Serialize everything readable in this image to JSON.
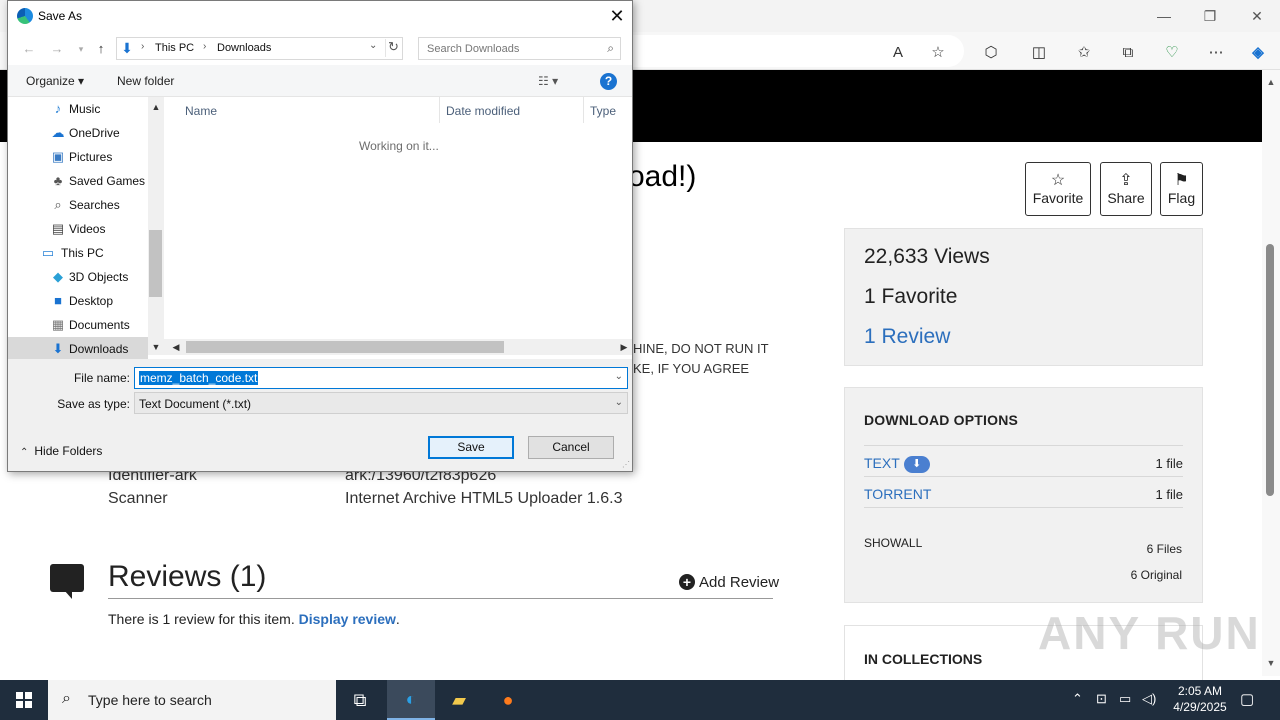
{
  "browser": {
    "window_controls": {
      "minimize": "—",
      "restore": "❐",
      "close": "✕"
    },
    "toolbar_icons": [
      "read-aloud-icon",
      "favorite-star-icon",
      "extensions-icon",
      "split-screen-icon",
      "favorites-icon",
      "collections-icon",
      "browser-essentials-icon",
      "more-icon",
      "copilot-icon"
    ]
  },
  "page": {
    "title_fragment": "oad!)",
    "actions": {
      "favorite": "Favorite",
      "share": "Share",
      "flag": "Flag"
    },
    "stats": {
      "views": "22,633 Views",
      "favorites": "1 Favorite",
      "reviews": "1 Review"
    },
    "download": {
      "title": "DOWNLOAD OPTIONS",
      "rows": [
        {
          "name": "TEXT",
          "count": "1 file"
        },
        {
          "name": "TORRENT",
          "count": "1 file"
        }
      ],
      "show_all": "SHOWALL",
      "files": "6 Files",
      "original": "6 Original"
    },
    "collections_title": "IN COLLECTIONS",
    "desc_fragment_1": "HINE, DO NOT RUN IT",
    "desc_fragment_2": "KE, IF YOU AGREE",
    "metadata": [
      {
        "key": "Identifier-ark",
        "value": "ark:/13960/t2f83p626"
      },
      {
        "key": "Scanner",
        "value": "Internet Archive HTML5 Uploader 1.6.3"
      }
    ],
    "reviews_heading": "Reviews (1)",
    "add_review": "Add Review",
    "review_text": "There is 1 review for this item.",
    "review_link": "Display review",
    "review_period": ".",
    "watermark": "ANY RUN"
  },
  "dialog": {
    "title": "Save As",
    "close": "✕",
    "breadcrumb": [
      "This PC",
      "Downloads"
    ],
    "search_placeholder": "Search Downloads",
    "organize": "Organize ▾",
    "new_folder": "New folder",
    "view": "☷ ▾",
    "help": "?",
    "tree": [
      {
        "label": "Music",
        "icon": "music-icon"
      },
      {
        "label": "OneDrive",
        "icon": "onedrive-icon"
      },
      {
        "label": "Pictures",
        "icon": "pictures-icon"
      },
      {
        "label": "Saved Games",
        "icon": "saved-games-icon"
      },
      {
        "label": "Searches",
        "icon": "searches-icon"
      },
      {
        "label": "Videos",
        "icon": "videos-icon"
      },
      {
        "label": "This PC",
        "icon": "this-pc-icon"
      },
      {
        "label": "3D Objects",
        "icon": "3d-objects-icon"
      },
      {
        "label": "Desktop",
        "icon": "desktop-icon"
      },
      {
        "label": "Documents",
        "icon": "documents-icon"
      },
      {
        "label": "Downloads",
        "icon": "downloads-icon"
      }
    ],
    "columns": {
      "name": "Name",
      "date": "Date modified",
      "type": "Type"
    },
    "status": "Working on it...",
    "file_name_label": "File name:",
    "file_name": "memz_batch_code.txt",
    "save_type_label": "Save as type:",
    "save_type": "Text Document (*.txt)",
    "hide_folders": "Hide Folders",
    "save": "Save",
    "cancel": "Cancel"
  },
  "taskbar": {
    "search_placeholder": "Type here to search",
    "time": "2:05 AM",
    "date": "4/29/2025"
  }
}
